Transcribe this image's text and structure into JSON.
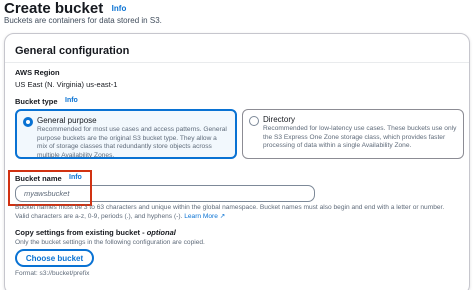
{
  "header": {
    "title": "Create bucket",
    "info": "Info",
    "subtitle": "Buckets are containers for data stored in S3."
  },
  "general": {
    "title": "General configuration",
    "region_label": "AWS Region",
    "region_value": "US East (N. Virginia) us-east-1",
    "bucket_type_label": "Bucket type",
    "bucket_type_info": "Info",
    "options": [
      {
        "title": "General purpose",
        "description": "Recommended for most use cases and access patterns. General\npurpose buckets are the original S3 bucket type. They allow a\nmix of storage classes that redundantly store objects across\nmultiple Availability Zones.",
        "selected": true
      },
      {
        "title": "Directory",
        "description": "Recommended for low-latency use cases. These buckets use only\nthe S3 Express One Zone storage class, which provides faster\nprocessing of data within a single Availability Zone.",
        "selected": false
      }
    ],
    "bucket_name_label": "Bucket name",
    "bucket_name_info": "Info",
    "bucket_name_value": "myawsbucket",
    "bucket_name_constraint": "Bucket names must be 3 to 63 characters and unique within the global namespace. Bucket names must also begin and end with a letter or number.\nValid characters are a-z, 0-9, periods (.), and hyphens (-).",
    "learn_more": "Learn More ↗",
    "copy_label": "Copy settings from existing bucket - ",
    "copy_optional": "optional",
    "copy_desc": "Only the bucket settings in the following configuration are copied.",
    "choose_button": "Choose bucket",
    "format": "Format: s3://bucket/prefix"
  },
  "colors": {
    "accent": "#0972d3",
    "highlight": "#d13212"
  }
}
